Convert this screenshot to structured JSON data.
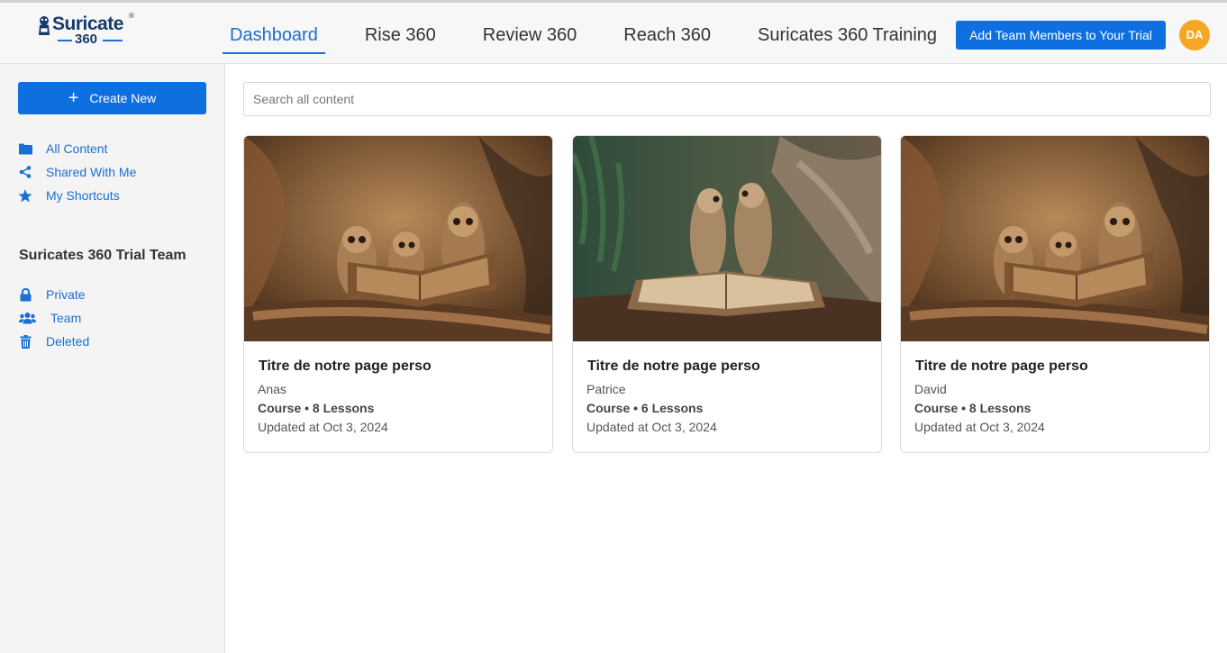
{
  "header": {
    "logo_text": "Suricate",
    "logo_mark": "®",
    "logo_number": "360",
    "nav": [
      {
        "label": "Dashboard",
        "active": true
      },
      {
        "label": "Rise 360",
        "active": false
      },
      {
        "label": "Review 360",
        "active": false
      },
      {
        "label": "Reach 360",
        "active": false
      },
      {
        "label": "Suricates 360 Training",
        "active": false
      }
    ],
    "cta_label": "Add Team Members to Your Trial",
    "avatar_initials": "DA",
    "accent_color": "#0d6fe0",
    "avatar_color": "#f5a623"
  },
  "sidebar": {
    "create_label": "Create New",
    "links": [
      {
        "label": "All Content",
        "icon": "folder-icon"
      },
      {
        "label": "Shared With Me",
        "icon": "share-icon"
      },
      {
        "label": "My Shortcuts",
        "icon": "star-icon"
      }
    ],
    "team_title": "Suricates 360 Trial Team",
    "team_links": [
      {
        "label": "Private",
        "icon": "lock-icon"
      },
      {
        "label": "Team",
        "icon": "users-icon"
      },
      {
        "label": "Deleted",
        "icon": "trash-icon"
      }
    ]
  },
  "main": {
    "search_placeholder": "Search all content",
    "cards": [
      {
        "title": "Titre de notre page perso",
        "author": "Anas",
        "meta": "Course • 8 Lessons",
        "updated": "Updated at Oct 3, 2024",
        "image": "meerkats-reading-book"
      },
      {
        "title": "Titre de notre page perso",
        "author": "Patrice",
        "meta": "Course • 6 Lessons",
        "updated": "Updated at Oct 3, 2024",
        "image": "meerkats-on-book"
      },
      {
        "title": "Titre de notre page perso",
        "author": "David",
        "meta": "Course • 8 Lessons",
        "updated": "Updated at Oct 3, 2024",
        "image": "meerkats-reading-book"
      }
    ]
  }
}
